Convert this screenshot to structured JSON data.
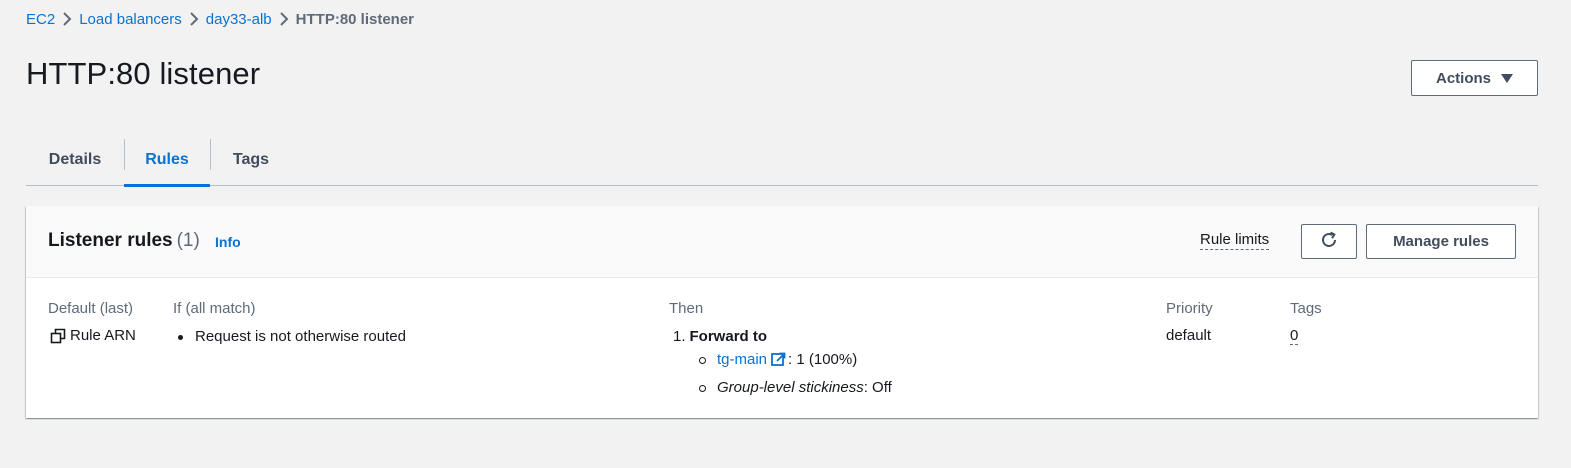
{
  "breadcrumb": {
    "items": [
      "EC2",
      "Load balancers",
      "day33-alb"
    ],
    "current": "HTTP:80 listener"
  },
  "header": {
    "title": "HTTP:80 listener",
    "actions_label": "Actions"
  },
  "tabs": [
    {
      "label": "Details"
    },
    {
      "label": "Rules",
      "active": true
    },
    {
      "label": "Tags"
    }
  ],
  "panel": {
    "title": "Listener rules",
    "count": "(1)",
    "info": "Info",
    "rule_limits": "Rule limits",
    "manage_label": "Manage rules",
    "columns": {
      "default": "Default (last)",
      "condition": "If (all match)",
      "then": "Then",
      "priority": "Priority",
      "tags": "Tags"
    },
    "rule": {
      "arn_label": "Rule ARN",
      "condition": "Request is not otherwise routed",
      "action_num": "1.",
      "action": "Forward to",
      "target_group": "tg-main",
      "target_weight": ": 1 (100%)",
      "stickiness_label": "Group-level stickiness",
      "stickiness_value": ": Off",
      "priority": "default",
      "tags": "0"
    }
  },
  "colors": {
    "accent": "#0972d3",
    "background": "#f2f2f2",
    "text": "#16191f",
    "muted": "#5f6b7a"
  }
}
